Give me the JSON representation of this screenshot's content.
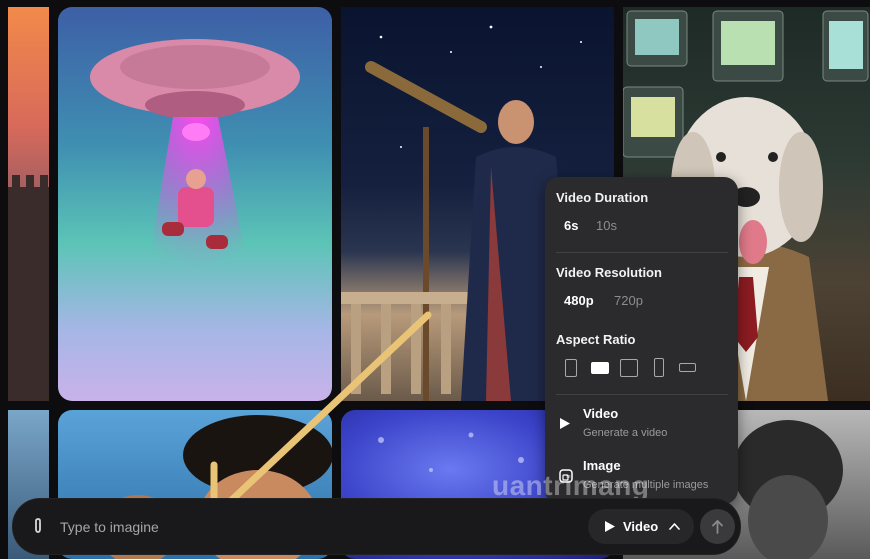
{
  "panel": {
    "duration": {
      "title": "Video Duration",
      "options": [
        "6s",
        "10s"
      ],
      "selected": "6s"
    },
    "resolution": {
      "title": "Video Resolution",
      "options": [
        "480p",
        "720p"
      ],
      "selected": "480p"
    },
    "aspect": {
      "title": "Aspect Ratio",
      "ratios": [
        "2:3",
        "3:2",
        "1:1",
        "9:16",
        "16:9"
      ],
      "selected": "3:2"
    },
    "modes": [
      {
        "title": "Video",
        "subtitle": "Generate a video",
        "icon": "play-icon"
      },
      {
        "title": "Image",
        "subtitle": "Generate multiple images",
        "icon": "image-icon"
      }
    ]
  },
  "prompt": {
    "placeholder": "Type to imagine",
    "mode_label": "Video"
  },
  "watermark": "uantrimang",
  "colors": {
    "panel_bg": "#2b2b2d",
    "bar_bg": "#19191b",
    "arrow": "#e9c476"
  }
}
